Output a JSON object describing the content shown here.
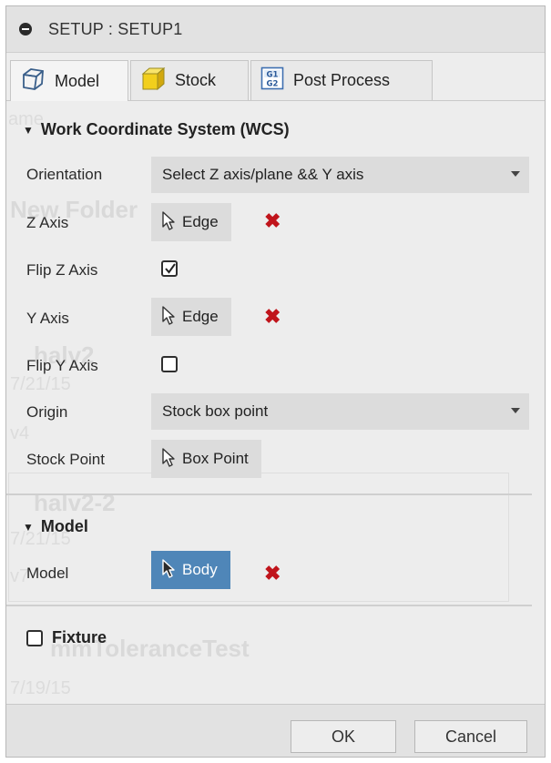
{
  "dialog": {
    "title": "SETUP : SETUP1"
  },
  "tabs": [
    {
      "label": "Model",
      "icon": "model-cube-icon",
      "active": true
    },
    {
      "label": "Stock",
      "icon": "stock-box-icon",
      "active": false
    },
    {
      "label": "Post Process",
      "icon": "g1g2-icon",
      "active": false
    }
  ],
  "background_ghost": {
    "line1": "ame",
    "line2": "New Folder",
    "line3": "halv2",
    "line4": "7/21/15",
    "line5": "v4",
    "line6": "halv2-2",
    "line7": "7/21/15",
    "line8": "v7",
    "line9": "mmToleranceTest",
    "line10": "7/19/15"
  },
  "wcs": {
    "header": "Work Coordinate System (WCS)",
    "orientation_label": "Orientation",
    "orientation_value": "Select Z axis/plane && Y axis",
    "z_axis_label": "Z Axis",
    "z_axis_button": "Edge",
    "flip_z_label": "Flip Z Axis",
    "flip_z_checked": true,
    "y_axis_label": "Y Axis",
    "y_axis_button": "Edge",
    "flip_y_label": "Flip Y Axis",
    "flip_y_checked": false,
    "origin_label": "Origin",
    "origin_value": "Stock box point",
    "stock_point_label": "Stock Point",
    "stock_point_button": "Box Point"
  },
  "model_section": {
    "header": "Model",
    "model_label": "Model",
    "model_button": "Body"
  },
  "fixture": {
    "label": "Fixture",
    "checked": false
  },
  "footer": {
    "ok_label": "OK",
    "cancel_label": "Cancel"
  },
  "colors": {
    "accent": "#4f86b8",
    "remove_x": "#c0141b",
    "panel_bg": "#ededed"
  }
}
